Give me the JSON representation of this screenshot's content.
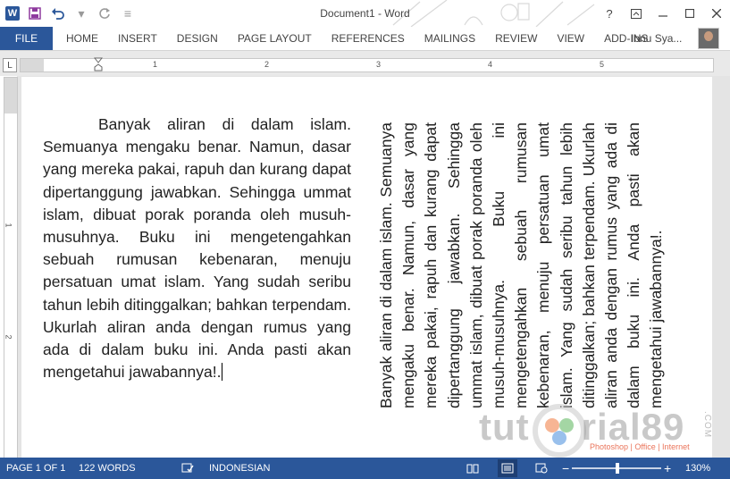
{
  "app": {
    "window_title": "Document1 - Word",
    "qat": {
      "logo_letter": "W",
      "save_icon": "save-icon",
      "undo_icon": "undo-icon",
      "redo_icon": "redo-icon",
      "customize_icon": "customize-icon"
    },
    "window_controls": [
      "help-icon",
      "ribbon-display-icon",
      "minimize-icon",
      "maximize-icon",
      "close-icon"
    ]
  },
  "ribbon": {
    "file_label": "FILE",
    "tabs": [
      "HOME",
      "INSERT",
      "DESIGN",
      "PAGE LAYOUT",
      "REFERENCES",
      "MAILINGS",
      "REVIEW",
      "VIEW",
      "ADD-INS"
    ],
    "user_name": "Ibnu Sya..."
  },
  "rulers": {
    "horizontal_numbers": [
      "1",
      "2",
      "3",
      "4",
      "5"
    ],
    "vertical_numbers": [
      "1",
      "2"
    ]
  },
  "document": {
    "left_text": "Banyak aliran di dalam islam. Semuanya mengaku benar. Namun, dasar yang mereka pakai, rapuh dan kurang dapat dipertanggung jawabkan. Sehingga ummat islam, dibuat porak poranda oleh musuh-musuhnya. Buku ini mengetengahkan sebuah rumusan kebenaran, menuju persatuan umat islam. Yang sudah seribu tahun lebih ditinggalkan; bahkan terpendam. Ukurlah aliran anda dengan rumus yang ada di dalam buku ini. Anda pasti akan mengetahui jawabannya!.",
    "rotated_text": "Banyak aliran di dalam islam. Semuanya mengaku benar. Namun, dasar yang mereka pakai, rapuh dan kurang dapat dipertanggung jawabkan. Sehingga ummat islam, dibuat porak poranda oleh musuh-musuhnya. Buku ini mengetengahkan sebuah rumusan kebenaran, menuju persatuan umat islam. Yang sudah seribu tahun lebih ditinggalkan; bahkan terpendam. Ukurlah aliran anda dengan rumus yang ada di dalam buku ini. Anda pasti akan mengetahui jawabannya!."
  },
  "watermark": {
    "brand_part1": "tut",
    "brand_part2": "rial89",
    "tagline": "Photoshop | Office | Internet",
    "com": ".COM"
  },
  "status_bar": {
    "page": "PAGE 1 OF 1",
    "words": "122 WORDS",
    "language": "INDONESIAN",
    "zoom": "130%",
    "zoom_minus": "−",
    "zoom_plus": "+"
  },
  "colors": {
    "accent": "#2b579a"
  }
}
